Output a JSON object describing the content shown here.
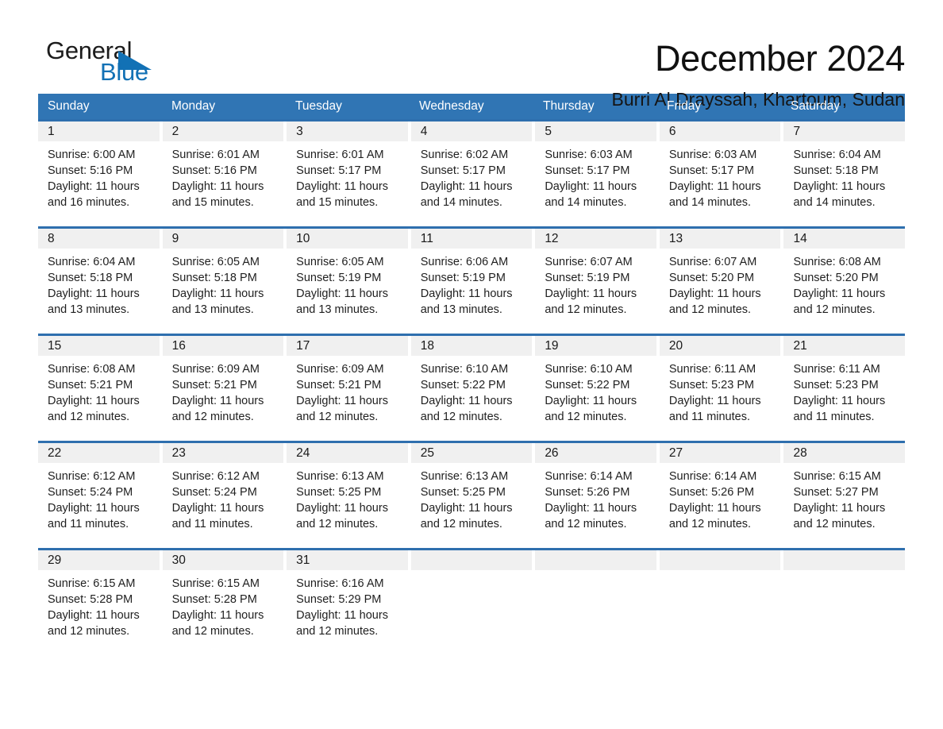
{
  "brand": {
    "name_part1": "General",
    "name_part2": "Blue",
    "triangle_color": "#1271b5",
    "text_color": "#1c1c1c"
  },
  "header": {
    "title": "December 2024",
    "location": "Burri Al Drayssah, Khartoum, Sudan"
  },
  "theme": {
    "header_blue": "#3075b4",
    "rule_blue": "#2e6fae",
    "daynum_background": "#f0f0f0",
    "page_background": "#ffffff"
  },
  "calendar": {
    "weekdays": [
      "Sunday",
      "Monday",
      "Tuesday",
      "Wednesday",
      "Thursday",
      "Friday",
      "Saturday"
    ],
    "weeks": [
      [
        {
          "day": "1",
          "lines": [
            "Sunrise: 6:00 AM",
            "Sunset: 5:16 PM",
            "Daylight: 11 hours",
            "and 16 minutes."
          ]
        },
        {
          "day": "2",
          "lines": [
            "Sunrise: 6:01 AM",
            "Sunset: 5:16 PM",
            "Daylight: 11 hours",
            "and 15 minutes."
          ]
        },
        {
          "day": "3",
          "lines": [
            "Sunrise: 6:01 AM",
            "Sunset: 5:17 PM",
            "Daylight: 11 hours",
            "and 15 minutes."
          ]
        },
        {
          "day": "4",
          "lines": [
            "Sunrise: 6:02 AM",
            "Sunset: 5:17 PM",
            "Daylight: 11 hours",
            "and 14 minutes."
          ]
        },
        {
          "day": "5",
          "lines": [
            "Sunrise: 6:03 AM",
            "Sunset: 5:17 PM",
            "Daylight: 11 hours",
            "and 14 minutes."
          ]
        },
        {
          "day": "6",
          "lines": [
            "Sunrise: 6:03 AM",
            "Sunset: 5:17 PM",
            "Daylight: 11 hours",
            "and 14 minutes."
          ]
        },
        {
          "day": "7",
          "lines": [
            "Sunrise: 6:04 AM",
            "Sunset: 5:18 PM",
            "Daylight: 11 hours",
            "and 14 minutes."
          ]
        }
      ],
      [
        {
          "day": "8",
          "lines": [
            "Sunrise: 6:04 AM",
            "Sunset: 5:18 PM",
            "Daylight: 11 hours",
            "and 13 minutes."
          ]
        },
        {
          "day": "9",
          "lines": [
            "Sunrise: 6:05 AM",
            "Sunset: 5:18 PM",
            "Daylight: 11 hours",
            "and 13 minutes."
          ]
        },
        {
          "day": "10",
          "lines": [
            "Sunrise: 6:05 AM",
            "Sunset: 5:19 PM",
            "Daylight: 11 hours",
            "and 13 minutes."
          ]
        },
        {
          "day": "11",
          "lines": [
            "Sunrise: 6:06 AM",
            "Sunset: 5:19 PM",
            "Daylight: 11 hours",
            "and 13 minutes."
          ]
        },
        {
          "day": "12",
          "lines": [
            "Sunrise: 6:07 AM",
            "Sunset: 5:19 PM",
            "Daylight: 11 hours",
            "and 12 minutes."
          ]
        },
        {
          "day": "13",
          "lines": [
            "Sunrise: 6:07 AM",
            "Sunset: 5:20 PM",
            "Daylight: 11 hours",
            "and 12 minutes."
          ]
        },
        {
          "day": "14",
          "lines": [
            "Sunrise: 6:08 AM",
            "Sunset: 5:20 PM",
            "Daylight: 11 hours",
            "and 12 minutes."
          ]
        }
      ],
      [
        {
          "day": "15",
          "lines": [
            "Sunrise: 6:08 AM",
            "Sunset: 5:21 PM",
            "Daylight: 11 hours",
            "and 12 minutes."
          ]
        },
        {
          "day": "16",
          "lines": [
            "Sunrise: 6:09 AM",
            "Sunset: 5:21 PM",
            "Daylight: 11 hours",
            "and 12 minutes."
          ]
        },
        {
          "day": "17",
          "lines": [
            "Sunrise: 6:09 AM",
            "Sunset: 5:21 PM",
            "Daylight: 11 hours",
            "and 12 minutes."
          ]
        },
        {
          "day": "18",
          "lines": [
            "Sunrise: 6:10 AM",
            "Sunset: 5:22 PM",
            "Daylight: 11 hours",
            "and 12 minutes."
          ]
        },
        {
          "day": "19",
          "lines": [
            "Sunrise: 6:10 AM",
            "Sunset: 5:22 PM",
            "Daylight: 11 hours",
            "and 12 minutes."
          ]
        },
        {
          "day": "20",
          "lines": [
            "Sunrise: 6:11 AM",
            "Sunset: 5:23 PM",
            "Daylight: 11 hours",
            "and 11 minutes."
          ]
        },
        {
          "day": "21",
          "lines": [
            "Sunrise: 6:11 AM",
            "Sunset: 5:23 PM",
            "Daylight: 11 hours",
            "and 11 minutes."
          ]
        }
      ],
      [
        {
          "day": "22",
          "lines": [
            "Sunrise: 6:12 AM",
            "Sunset: 5:24 PM",
            "Daylight: 11 hours",
            "and 11 minutes."
          ]
        },
        {
          "day": "23",
          "lines": [
            "Sunrise: 6:12 AM",
            "Sunset: 5:24 PM",
            "Daylight: 11 hours",
            "and 11 minutes."
          ]
        },
        {
          "day": "24",
          "lines": [
            "Sunrise: 6:13 AM",
            "Sunset: 5:25 PM",
            "Daylight: 11 hours",
            "and 12 minutes."
          ]
        },
        {
          "day": "25",
          "lines": [
            "Sunrise: 6:13 AM",
            "Sunset: 5:25 PM",
            "Daylight: 11 hours",
            "and 12 minutes."
          ]
        },
        {
          "day": "26",
          "lines": [
            "Sunrise: 6:14 AM",
            "Sunset: 5:26 PM",
            "Daylight: 11 hours",
            "and 12 minutes."
          ]
        },
        {
          "day": "27",
          "lines": [
            "Sunrise: 6:14 AM",
            "Sunset: 5:26 PM",
            "Daylight: 11 hours",
            "and 12 minutes."
          ]
        },
        {
          "day": "28",
          "lines": [
            "Sunrise: 6:15 AM",
            "Sunset: 5:27 PM",
            "Daylight: 11 hours",
            "and 12 minutes."
          ]
        }
      ],
      [
        {
          "day": "29",
          "lines": [
            "Sunrise: 6:15 AM",
            "Sunset: 5:28 PM",
            "Daylight: 11 hours",
            "and 12 minutes."
          ]
        },
        {
          "day": "30",
          "lines": [
            "Sunrise: 6:15 AM",
            "Sunset: 5:28 PM",
            "Daylight: 11 hours",
            "and 12 minutes."
          ]
        },
        {
          "day": "31",
          "lines": [
            "Sunrise: 6:16 AM",
            "Sunset: 5:29 PM",
            "Daylight: 11 hours",
            "and 12 minutes."
          ]
        },
        {
          "day": "",
          "lines": []
        },
        {
          "day": "",
          "lines": []
        },
        {
          "day": "",
          "lines": []
        },
        {
          "day": "",
          "lines": []
        }
      ]
    ]
  }
}
